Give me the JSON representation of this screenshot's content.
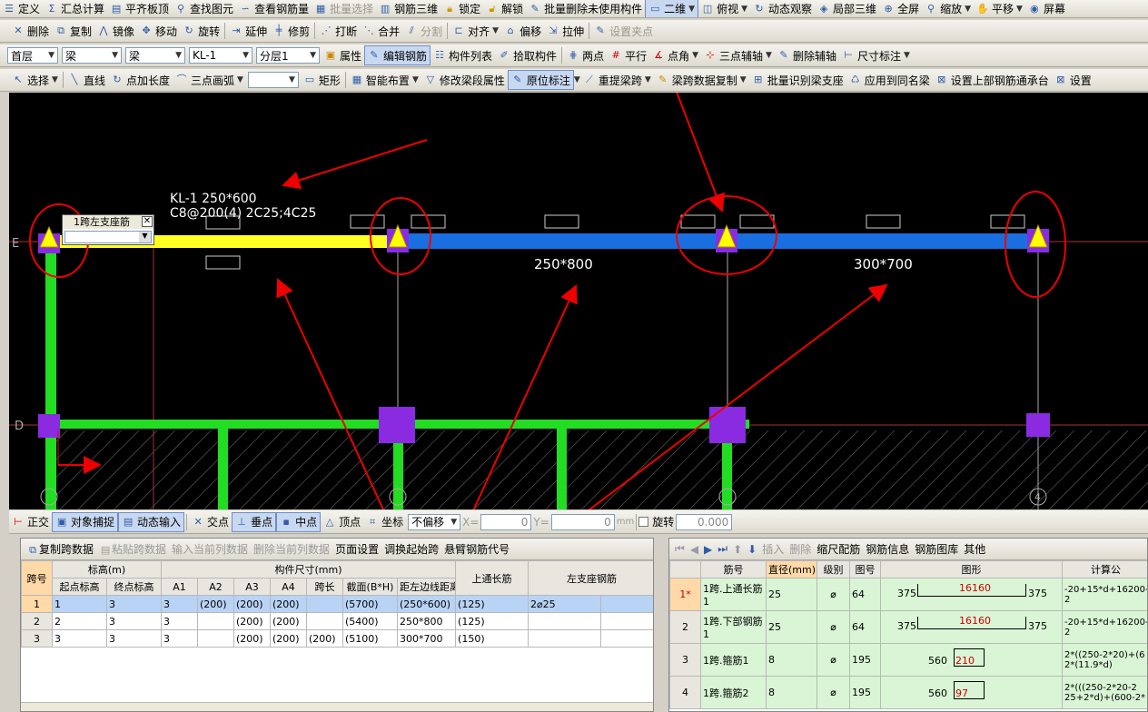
{
  "toolbar1": [
    "定义",
    "汇总计算",
    "平齐板顶",
    "查找图元",
    "查看钢筋量",
    "批量选择",
    "钢筋三维",
    "锁定",
    "解锁",
    "批量删除未使用构件",
    "二维",
    "俯视",
    "动态观察",
    "局部三维",
    "全屏",
    "缩放",
    "平移",
    "屏幕"
  ],
  "toolbar2": [
    "删除",
    "复制",
    "镜像",
    "移动",
    "旋转",
    "延伸",
    "修剪",
    "打断",
    "合并",
    "分割",
    "对齐",
    "偏移",
    "拉伸",
    "设置夹点"
  ],
  "toolbar3": {
    "floor": "首层",
    "cat": "梁",
    "type": "梁",
    "comp": "KL-1",
    "layer": "分层1",
    "items": [
      "属性",
      "编辑钢筋",
      "构件列表",
      "拾取构件",
      "两点",
      "平行",
      "点角",
      "三点辅轴",
      "删除辅轴",
      "尺寸标注"
    ]
  },
  "toolbar4": [
    "选择",
    "直线",
    "点加长度",
    "三点画弧",
    "矩形",
    "智能布置",
    "修改梁段属性",
    "原位标注",
    "重提梁跨",
    "梁跨数据复制",
    "批量识别梁支座",
    "应用到同名梁",
    "设置上部钢筋通承台",
    "设置"
  ],
  "canvas": {
    "beam_label1": "KL-1 250*600",
    "beam_label2": "C8@200(4) 2C25;4C25",
    "popup_title": "1跨左支座筋",
    "sec1": "250*800",
    "sec2": "300*700",
    "axis_e": "E",
    "axis_d": "D",
    "axis_4": "4"
  },
  "status": {
    "items": [
      "正交",
      "对象捕捉",
      "动态输入",
      "交点",
      "垂点",
      "中点",
      "顶点",
      "坐标"
    ],
    "move": "不偏移",
    "x_label": "X=",
    "x_val": "0",
    "y_label": "Y=",
    "y_val": "0",
    "unit": "mm",
    "rotate": "旋转",
    "rotate_val": "0.000"
  },
  "left_panel": {
    "tools": [
      "复制跨数据",
      "粘贴跨数据",
      "输入当前列数据",
      "删除当前列数据",
      "页面设置",
      "调换起始跨",
      "悬臂钢筋代号"
    ],
    "h1": [
      "跨号",
      "标高(m)",
      "构件尺寸(mm)",
      "上通长筋",
      "左支座钢筋"
    ],
    "h2": [
      "起点标高",
      "终点标高",
      "A1",
      "A2",
      "A3",
      "A4",
      "跨长",
      "截面(B*H)",
      "距左边线距离"
    ],
    "rows": [
      [
        "1",
        "1",
        "3",
        "3",
        "(200)",
        "(200)",
        "(200)",
        "",
        "(5700)",
        "(250*600)",
        "(125)",
        "2⌀25",
        ""
      ],
      [
        "2",
        "2",
        "3",
        "3",
        "",
        "(200)",
        "(200)",
        "",
        "(5400)",
        "250*800",
        "(125)",
        "",
        ""
      ],
      [
        "3",
        "3",
        "3",
        "3",
        "",
        "(200)",
        "(200)",
        "(200)",
        "(5100)",
        "300*700",
        "(150)",
        "",
        ""
      ]
    ]
  },
  "right_panel": {
    "tools": [
      "插入",
      "删除",
      "缩尺配筋",
      "钢筋信息",
      "钢筋图库",
      "其他"
    ],
    "headers": [
      "筋号",
      "直径(mm)",
      "级别",
      "图号",
      "图形",
      "计算公"
    ],
    "rows": [
      [
        "1*",
        "1跨.上通长筋1",
        "25",
        "⌀",
        "64",
        "375",
        "16160",
        "375",
        "-20+15*d+16200-2"
      ],
      [
        "2",
        "1跨.下部钢筋1",
        "25",
        "⌀",
        "64",
        "375",
        "16160",
        "375",
        "-20+15*d+16200-2"
      ],
      [
        "3",
        "1跨.箍筋1",
        "8",
        "⌀",
        "195",
        "560",
        "210",
        "",
        "2*((250-2*20)+(6 2*(11.9*d)"
      ],
      [
        "4",
        "1跨.箍筋2",
        "8",
        "⌀",
        "195",
        "560",
        "97",
        "",
        "2*(((250-2*20-2 25+2*d)+(600-2*"
      ]
    ]
  }
}
